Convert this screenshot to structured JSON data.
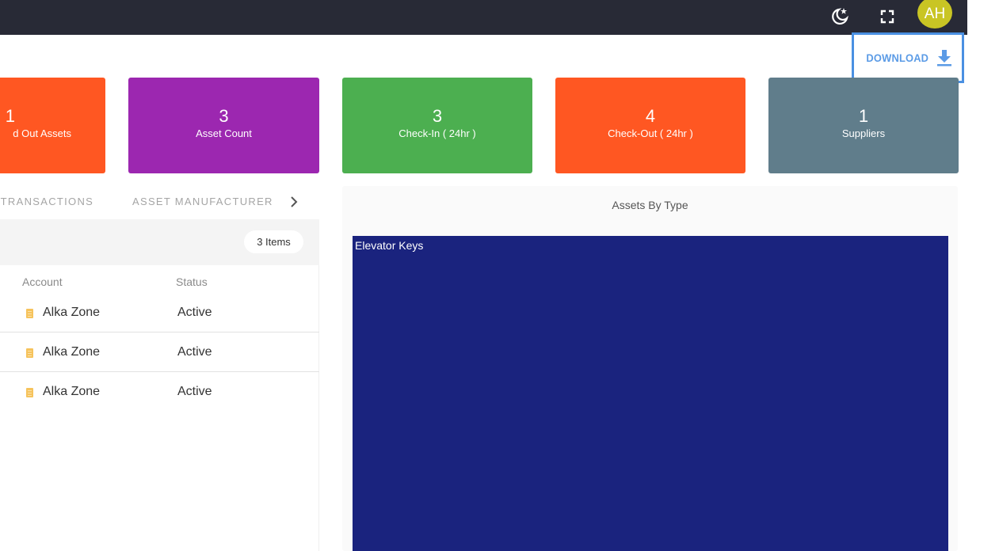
{
  "topbar": {
    "avatar_initials": "AH",
    "icons": [
      "moon-star-icon",
      "fullscreen-icon"
    ]
  },
  "toolbar": {
    "download_label": "DOWNLOAD"
  },
  "cards": [
    {
      "value": "1",
      "label": "d Out Assets",
      "color": "#ff5722"
    },
    {
      "value": "3",
      "label": "Asset Count",
      "color": "#9c27b0"
    },
    {
      "value": "3",
      "label": "Check-In ( 24hr )",
      "color": "#4caf50"
    },
    {
      "value": "4",
      "label": "Check-Out ( 24hr )",
      "color": "#ff5722"
    },
    {
      "value": "1",
      "label": "Suppliers",
      "color": "#607d8b"
    }
  ],
  "tabs": [
    {
      "label": "T TRANSACTIONS"
    },
    {
      "label": "ASSET MANUFACTURER"
    }
  ],
  "table": {
    "count_label": "3 Items",
    "columns": [
      "Account",
      "Status"
    ],
    "rows": [
      {
        "account": "Alka Zone",
        "status": "Active"
      },
      {
        "account": "Alka Zone",
        "status": "Active"
      },
      {
        "account": "Alka Zone",
        "status": "Active"
      }
    ]
  },
  "chart_data": {
    "type": "treemap",
    "title": "Assets By Type",
    "items": [
      {
        "label": "Elevator Keys",
        "share": 1.0,
        "color": "#1a237e"
      }
    ]
  }
}
